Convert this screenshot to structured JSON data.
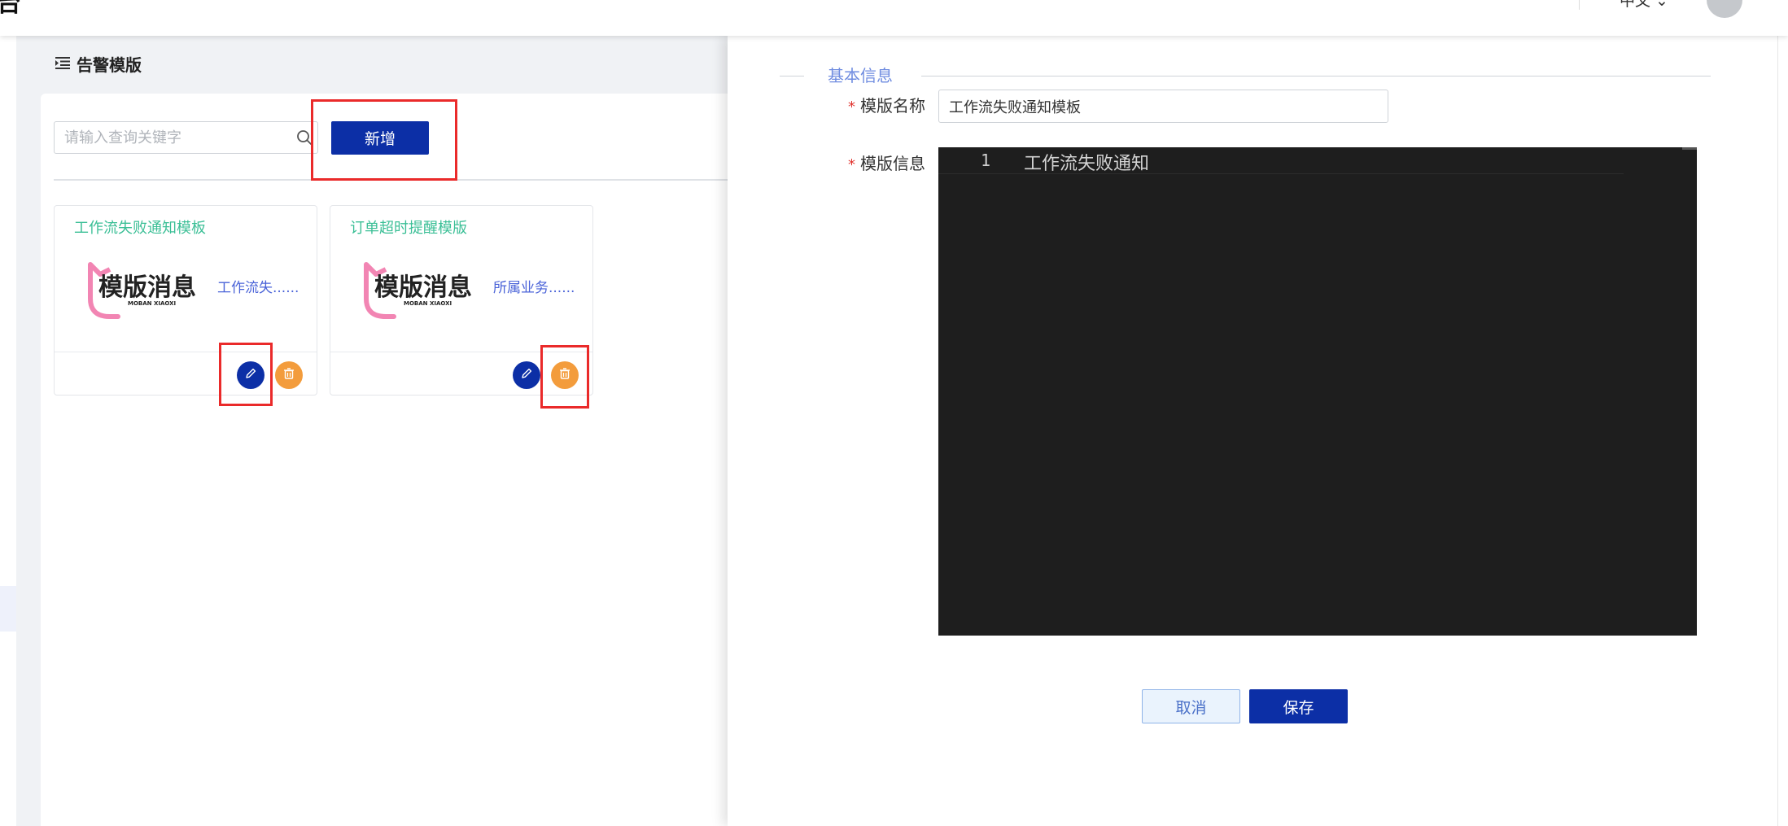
{
  "header": {
    "title_fragment": "台",
    "language": "中文 ⌄"
  },
  "section": {
    "icon": "indent-list-icon",
    "title": "告警模版"
  },
  "search": {
    "placeholder": "请输入查询关键字",
    "value": ""
  },
  "toolbar": {
    "add_label": "新增"
  },
  "cards": [
    {
      "title": "工作流失败通知模板",
      "logo_text": "模版消息",
      "logo_sub": "MOBAN XIAOXI",
      "description": "工作流失......"
    },
    {
      "title": "订单超时提醒模版",
      "logo_text": "模版消息",
      "logo_sub": "MOBAN XIAOXI",
      "description": "所属业务......"
    }
  ],
  "drawer": {
    "legend": "基本信息",
    "required_mark": "*",
    "name_label": "模版名称",
    "name_value": "工作流失败通知模板",
    "info_label": "模版信息",
    "editor": {
      "line_number": "1",
      "content": "工作流失败通知"
    },
    "cancel_label": "取消",
    "save_label": "保存"
  },
  "colors": {
    "primary": "#0c2fa6",
    "danger": "#f39c3c",
    "card_title": "#3bbf96",
    "highlight": "#ea2a2a",
    "editor_bg": "#1e1e1e"
  }
}
